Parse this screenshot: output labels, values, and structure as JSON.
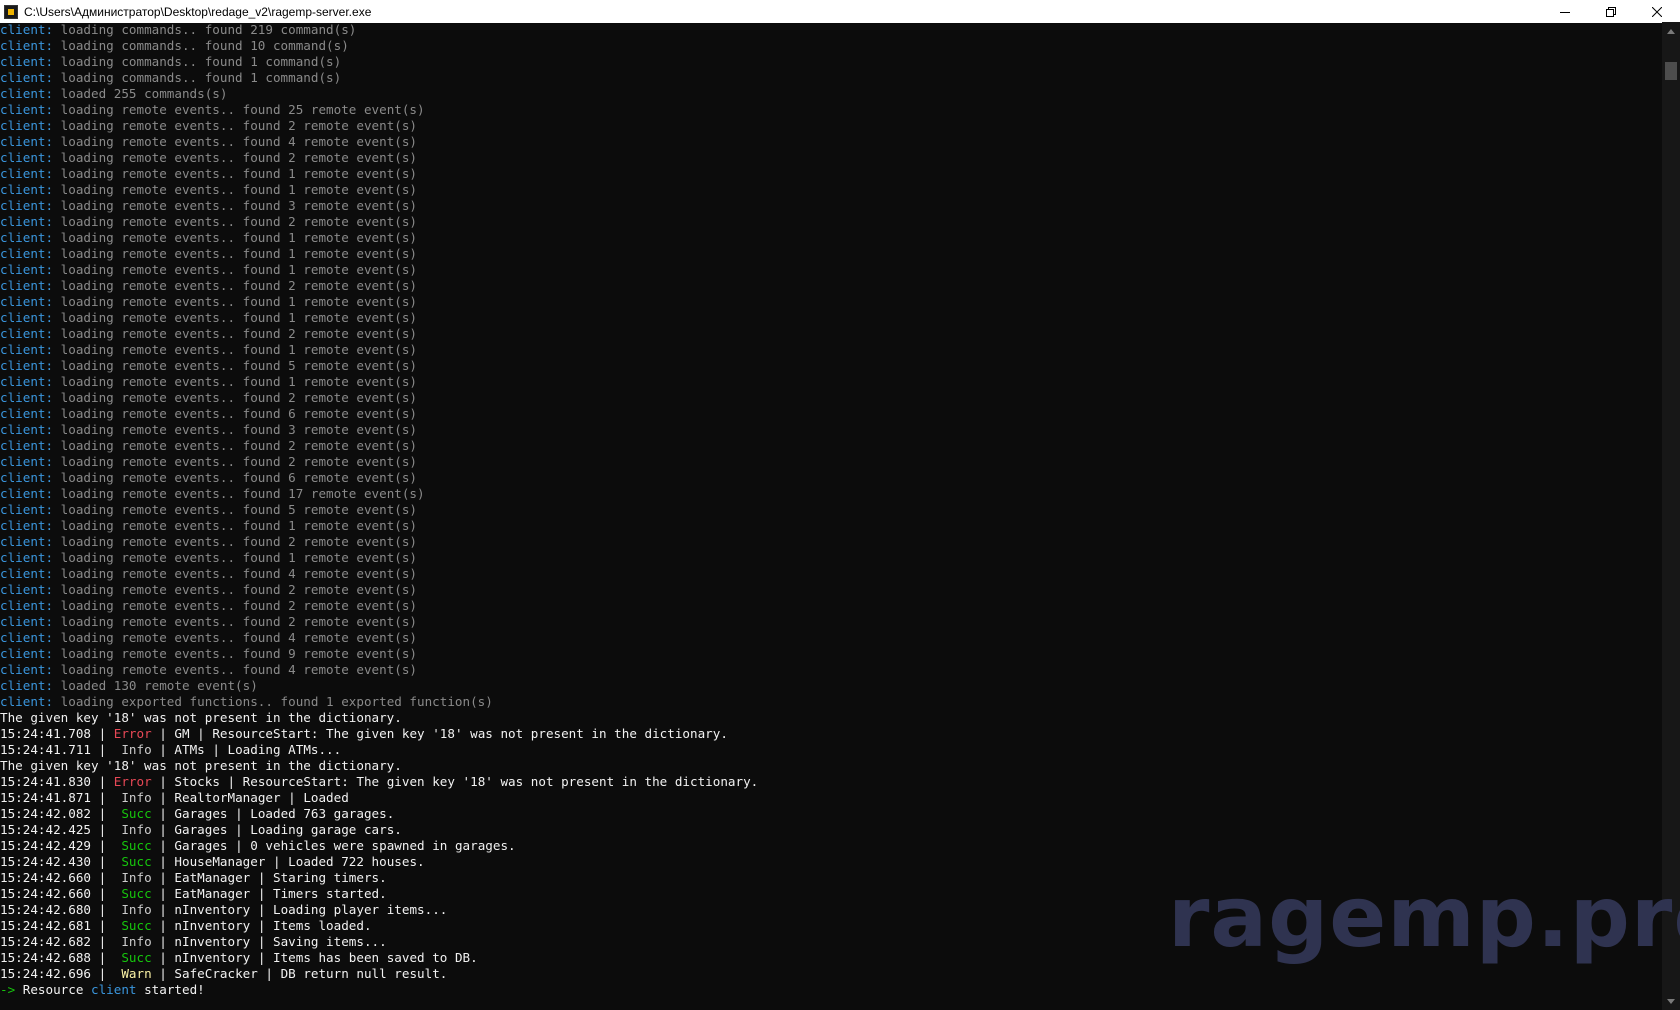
{
  "window": {
    "title": "C:\\Users\\Администратор\\Desktop\\redage_v2\\ragemp-server.exe",
    "icon": "ragemp-app-icon"
  },
  "console": {
    "client_lines": [
      {
        "prefix": "client:",
        "text": " loading commands.. found 219 command(s)"
      },
      {
        "prefix": "client:",
        "text": " loading commands.. found 10 command(s)"
      },
      {
        "prefix": "client:",
        "text": " loading commands.. found 1 command(s)"
      },
      {
        "prefix": "client:",
        "text": " loading commands.. found 1 command(s)"
      },
      {
        "prefix": "client:",
        "text": " loaded 255 commands(s)"
      },
      {
        "prefix": "client:",
        "text": " loading remote events.. found 25 remote event(s)"
      },
      {
        "prefix": "client:",
        "text": " loading remote events.. found 2 remote event(s)"
      },
      {
        "prefix": "client:",
        "text": " loading remote events.. found 4 remote event(s)"
      },
      {
        "prefix": "client:",
        "text": " loading remote events.. found 2 remote event(s)"
      },
      {
        "prefix": "client:",
        "text": " loading remote events.. found 1 remote event(s)"
      },
      {
        "prefix": "client:",
        "text": " loading remote events.. found 1 remote event(s)"
      },
      {
        "prefix": "client:",
        "text": " loading remote events.. found 3 remote event(s)"
      },
      {
        "prefix": "client:",
        "text": " loading remote events.. found 2 remote event(s)"
      },
      {
        "prefix": "client:",
        "text": " loading remote events.. found 1 remote event(s)"
      },
      {
        "prefix": "client:",
        "text": " loading remote events.. found 1 remote event(s)"
      },
      {
        "prefix": "client:",
        "text": " loading remote events.. found 1 remote event(s)"
      },
      {
        "prefix": "client:",
        "text": " loading remote events.. found 2 remote event(s)"
      },
      {
        "prefix": "client:",
        "text": " loading remote events.. found 1 remote event(s)"
      },
      {
        "prefix": "client:",
        "text": " loading remote events.. found 1 remote event(s)"
      },
      {
        "prefix": "client:",
        "text": " loading remote events.. found 2 remote event(s)"
      },
      {
        "prefix": "client:",
        "text": " loading remote events.. found 1 remote event(s)"
      },
      {
        "prefix": "client:",
        "text": " loading remote events.. found 5 remote event(s)"
      },
      {
        "prefix": "client:",
        "text": " loading remote events.. found 1 remote event(s)"
      },
      {
        "prefix": "client:",
        "text": " loading remote events.. found 2 remote event(s)"
      },
      {
        "prefix": "client:",
        "text": " loading remote events.. found 6 remote event(s)"
      },
      {
        "prefix": "client:",
        "text": " loading remote events.. found 3 remote event(s)"
      },
      {
        "prefix": "client:",
        "text": " loading remote events.. found 2 remote event(s)"
      },
      {
        "prefix": "client:",
        "text": " loading remote events.. found 2 remote event(s)"
      },
      {
        "prefix": "client:",
        "text": " loading remote events.. found 6 remote event(s)"
      },
      {
        "prefix": "client:",
        "text": " loading remote events.. found 17 remote event(s)"
      },
      {
        "prefix": "client:",
        "text": " loading remote events.. found 5 remote event(s)"
      },
      {
        "prefix": "client:",
        "text": " loading remote events.. found 1 remote event(s)"
      },
      {
        "prefix": "client:",
        "text": " loading remote events.. found 2 remote event(s)"
      },
      {
        "prefix": "client:",
        "text": " loading remote events.. found 1 remote event(s)"
      },
      {
        "prefix": "client:",
        "text": " loading remote events.. found 4 remote event(s)"
      },
      {
        "prefix": "client:",
        "text": " loading remote events.. found 2 remote event(s)"
      },
      {
        "prefix": "client:",
        "text": " loading remote events.. found 2 remote event(s)"
      },
      {
        "prefix": "client:",
        "text": " loading remote events.. found 2 remote event(s)"
      },
      {
        "prefix": "client:",
        "text": " loading remote events.. found 4 remote event(s)"
      },
      {
        "prefix": "client:",
        "text": " loading remote events.. found 9 remote event(s)"
      },
      {
        "prefix": "client:",
        "text": " loading remote events.. found 4 remote event(s)"
      },
      {
        "prefix": "client:",
        "text": " loaded 130 remote event(s)"
      },
      {
        "prefix": "client:",
        "text": " loading exported functions.. found 1 exported function(s)"
      }
    ],
    "log_lines": [
      {
        "kind": "plain",
        "text": "The given key '18' was not present in the dictionary."
      },
      {
        "kind": "log",
        "time": "15:24:41.708",
        "level": "Error",
        "level_class": "lvl-error",
        "text": " | GM | ResourceStart: The given key '18' was not present in the dictionary."
      },
      {
        "kind": "log",
        "time": "15:24:41.711",
        "level": " Info",
        "level_class": "lvl-info",
        "text": " | ATMs | Loading ATMs..."
      },
      {
        "kind": "plain",
        "text": "The given key '18' was not present in the dictionary."
      },
      {
        "kind": "log",
        "time": "15:24:41.830",
        "level": "Error",
        "level_class": "lvl-error",
        "text": " | Stocks | ResourceStart: The given key '18' was not present in the dictionary."
      },
      {
        "kind": "log",
        "time": "15:24:41.871",
        "level": " Info",
        "level_class": "lvl-info",
        "text": " | RealtorManager | Loaded"
      },
      {
        "kind": "log",
        "time": "15:24:42.082",
        "level": " Succ",
        "level_class": "lvl-succ",
        "text": " | Garages | Loaded 763 garages."
      },
      {
        "kind": "log",
        "time": "15:24:42.425",
        "level": " Info",
        "level_class": "lvl-info",
        "text": " | Garages | Loading garage cars."
      },
      {
        "kind": "log",
        "time": "15:24:42.429",
        "level": " Succ",
        "level_class": "lvl-succ",
        "text": " | Garages | 0 vehicles were spawned in garages."
      },
      {
        "kind": "log",
        "time": "15:24:42.430",
        "level": " Succ",
        "level_class": "lvl-succ",
        "text": " | HouseManager | Loaded 722 houses."
      },
      {
        "kind": "log",
        "time": "15:24:42.660",
        "level": " Info",
        "level_class": "lvl-info",
        "text": " | EatManager | Staring timers."
      },
      {
        "kind": "log",
        "time": "15:24:42.660",
        "level": " Succ",
        "level_class": "lvl-succ",
        "text": " | EatManager | Timers started."
      },
      {
        "kind": "log",
        "time": "15:24:42.680",
        "level": " Info",
        "level_class": "lvl-info",
        "text": " | nInventory | Loading player items..."
      },
      {
        "kind": "log",
        "time": "15:24:42.681",
        "level": " Succ",
        "level_class": "lvl-succ",
        "text": " | nInventory | Items loaded."
      },
      {
        "kind": "log",
        "time": "15:24:42.682",
        "level": " Info",
        "level_class": "lvl-info",
        "text": " | nInventory | Saving items..."
      },
      {
        "kind": "log",
        "time": "15:24:42.688",
        "level": " Succ",
        "level_class": "lvl-succ",
        "text": " | nInventory | Items has been saved to DB."
      },
      {
        "kind": "log",
        "time": "15:24:42.696",
        "level": " Warn",
        "level_class": "lvl-warn",
        "text": " | SafeCracker | DB return null result."
      }
    ],
    "final_line": {
      "prompt": "->",
      "before": " Resource ",
      "resource": "client",
      "after": " started!"
    }
  },
  "watermark": "ragemp.pro",
  "colors": {
    "background": "#0c0c0c",
    "client_prefix": "#3a96dd",
    "error": "#e74856",
    "success": "#16c60c",
    "warn": "#f9f1a5"
  }
}
